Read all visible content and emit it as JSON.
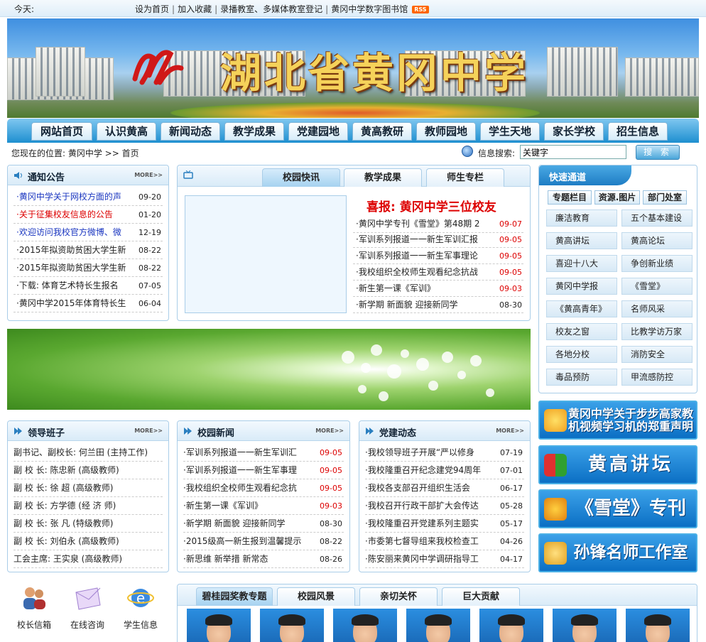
{
  "topbar": {
    "today": "今天:",
    "links": [
      "设为首页",
      "加入收藏",
      "录播教室、多媒体教室登记",
      "黄冈中学数字图书馆"
    ],
    "rss": "RSS"
  },
  "banner": {
    "title": "湖北省黄冈中学"
  },
  "nav": [
    "网站首页",
    "认识黄高",
    "新闻动态",
    "教学成果",
    "党建园地",
    "黄高教研",
    "教师园地",
    "学生天地",
    "家长学校",
    "招生信息"
  ],
  "location": "您现在的位置: 黄冈中学 >> 首页",
  "search": {
    "label": "信息搜索:",
    "value": "关键字",
    "button": "搜 索"
  },
  "notice": {
    "title": "通知公告",
    "more": "MORE>>",
    "items": [
      {
        "text": "·黄冈中学关于网校方面的声",
        "date": "09-20"
      },
      {
        "text": "·关于征集校友信息的公告",
        "date": "01-20"
      },
      {
        "text": "·欢迎访问我校官方微博、微",
        "date": "12-19"
      },
      {
        "text": "·2015年拟资助贫困大学生新",
        "date": "08-22"
      },
      {
        "text": "·2015年拟资助贫困大学生新",
        "date": "08-22"
      },
      {
        "text": "·下载: 体育艺术特长生报名",
        "date": "07-05"
      },
      {
        "text": "·黄冈中学2015年体育特长生",
        "date": "06-04"
      }
    ]
  },
  "campus": {
    "tabs": [
      "校园快讯",
      "教学成果",
      "师生专栏"
    ],
    "headline": "喜报: 黄冈中学三位校友",
    "items": [
      {
        "text": "·黄冈中学专刊《雪堂》第48期 2",
        "date": "09-07"
      },
      {
        "text": "·军训系列报道一一新生军训汇报",
        "date": "09-05"
      },
      {
        "text": "·军训系列报道一一新生军事理论",
        "date": "09-05"
      },
      {
        "text": "·我校组织全校师生观看纪念抗战",
        "date": "09-05"
      },
      {
        "text": "·新生第一课《军训》",
        "date": "09-03"
      },
      {
        "text": "·新学期 新面貌 迎接新同学",
        "date": "08-30"
      }
    ]
  },
  "quick": {
    "title": "快速通道",
    "tags": [
      "专题栏目",
      "资源.图片",
      "部门处室"
    ],
    "cells": [
      [
        "廉洁教育",
        "五个基本建设"
      ],
      [
        "黄高讲坛",
        "黄高论坛"
      ],
      [
        "喜迎十八大",
        "争创新业绩"
      ],
      [
        "黄冈中学报",
        "《雪堂》"
      ],
      [
        "《黄高青年》",
        "名师风采"
      ],
      [
        "校友之窗",
        "比教学访万家"
      ],
      [
        "各地分校",
        "消防安全"
      ],
      [
        "毒品预防",
        "甲流感防控"
      ]
    ]
  },
  "ads": [
    "黄冈中学关于步步高家教机视频学习机的郑重声明",
    "黄高讲坛",
    "《雪堂》专刊",
    "孙锋名师工作室"
  ],
  "leaders": {
    "title": "领导班子",
    "more": "MORE>>",
    "items": [
      "副书记、副校长: 何兰田 (主持工作)",
      "副 校 长: 陈忠新 (高级教师)",
      "副 校 长: 徐 超 (高级教师)",
      "副 校 长: 方学德 (经 济 师)",
      "副 校 长: 张 凡 (特级教师)",
      "副 校 长: 刘伯永 (高级教师)",
      "工会主席: 王实泉 (高级教师)"
    ]
  },
  "news": {
    "title": "校园新闻",
    "more": "MORE>>",
    "items": [
      {
        "text": "·军训系列报道一一新生军训汇",
        "date": "09-05"
      },
      {
        "text": "·军训系列报道一一新生军事理",
        "date": "09-05"
      },
      {
        "text": "·我校组织全校师生观看纪念抗",
        "date": "09-05"
      },
      {
        "text": "·新生第一课《军训》",
        "date": "09-03"
      },
      {
        "text": "·新学期 新面貌 迎接新同学",
        "date": "08-30"
      },
      {
        "text": "·2015级高一新生报到温馨提示",
        "date": "08-22"
      },
      {
        "text": "·新思维  新举措  新常态",
        "date": "08-26"
      }
    ]
  },
  "party": {
    "title": "党建动态",
    "more": "MORE>>",
    "items": [
      {
        "text": "·我校领导班子开展“严以修身",
        "date": "07-19"
      },
      {
        "text": "·我校隆重召开纪念建党94周年",
        "date": "07-01"
      },
      {
        "text": "·我校各支部召开组织生活会",
        "date": "06-17"
      },
      {
        "text": "·我校召开行政干部扩大会传达",
        "date": "05-28"
      },
      {
        "text": "·我校隆重召开党建系列主题实",
        "date": "05-17"
      },
      {
        "text": "·市委第七督导组来我校检查工",
        "date": "04-26"
      },
      {
        "text": "·陈安丽来黄冈中学调研指导工",
        "date": "04-17"
      }
    ]
  },
  "services": [
    "校长信箱",
    "在线咨询",
    "学生信息"
  ],
  "bottomTabs": [
    "碧桂园奖教专题",
    "校园风景",
    "亲切关怀",
    "巨大贡献"
  ],
  "colors": {
    "accent": "#1e8fd0",
    "red": "#d00",
    "blue": "#1a36c0"
  }
}
